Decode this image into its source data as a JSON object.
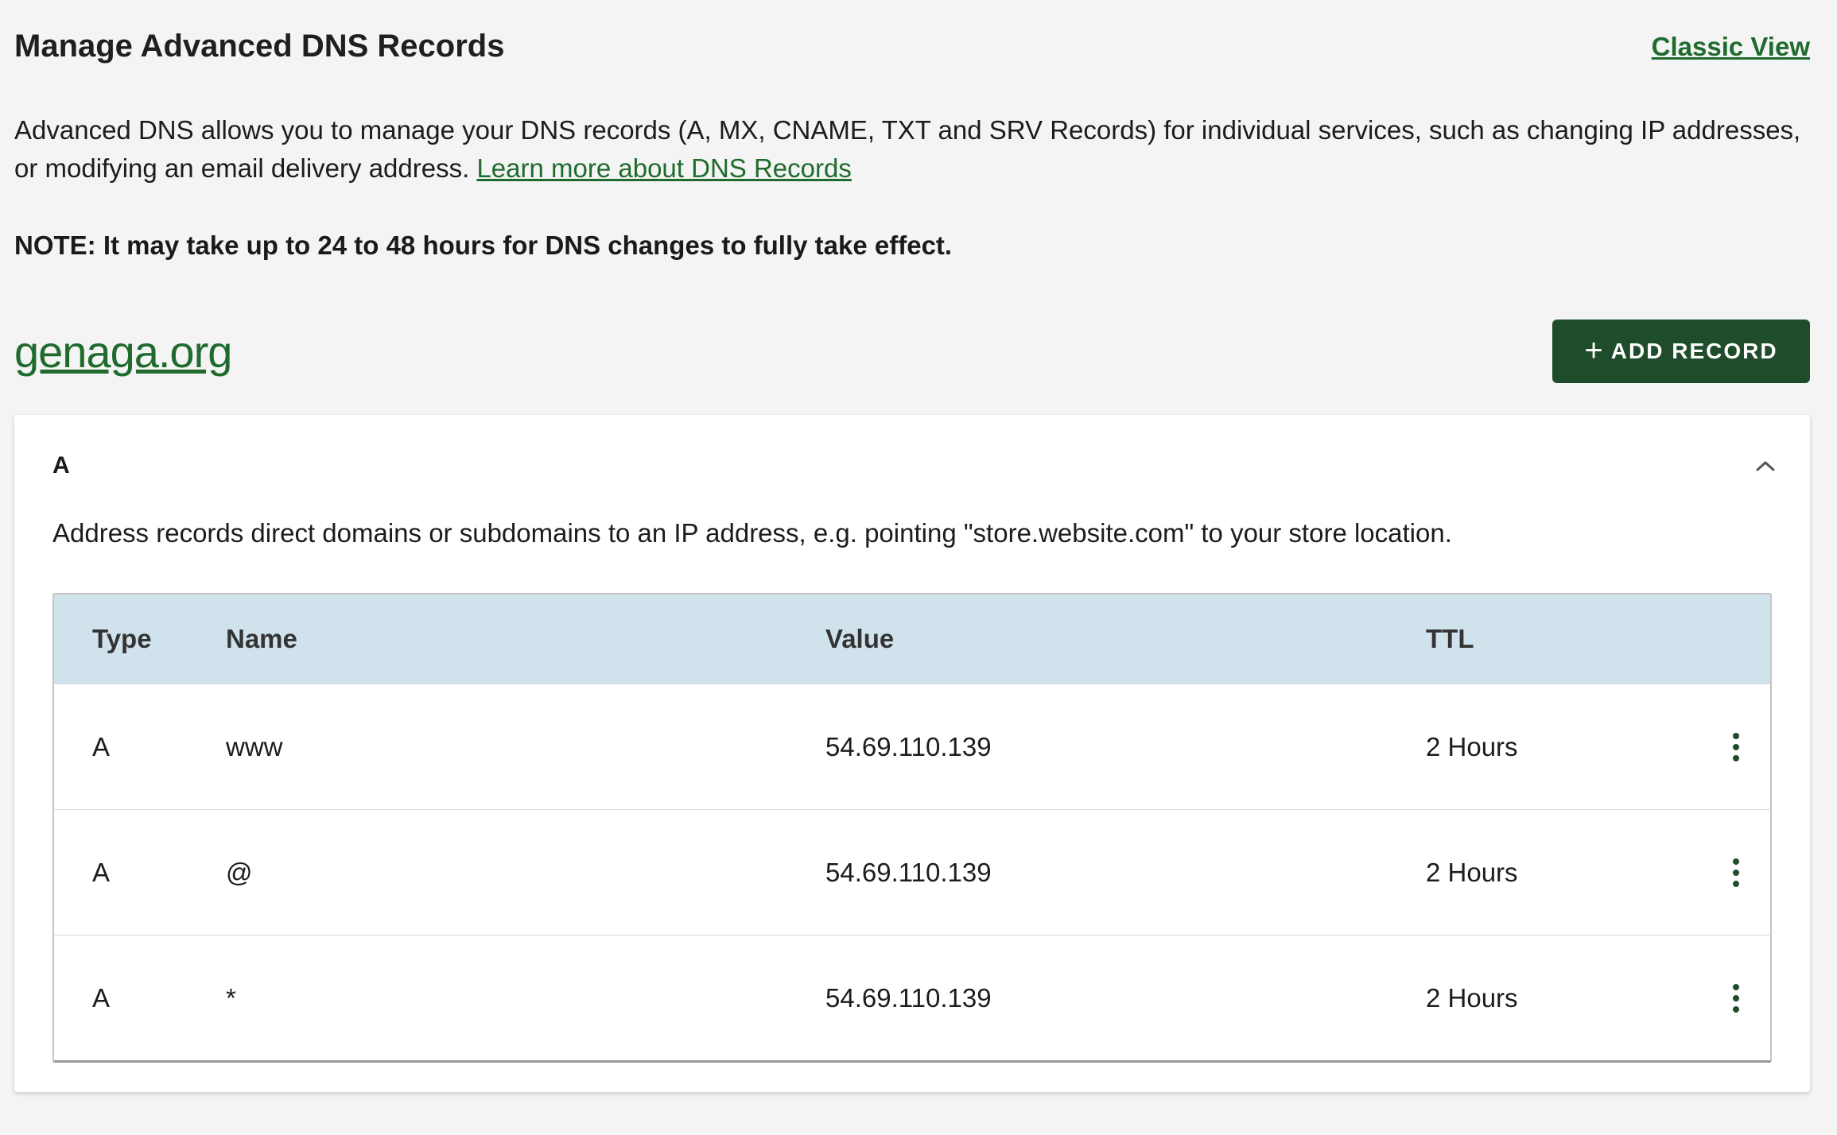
{
  "header": {
    "title": "Manage Advanced DNS Records",
    "classic_view": "Classic View"
  },
  "intro": {
    "text": "Advanced DNS allows you to manage your DNS records (A, MX, CNAME, TXT and SRV Records) for individual services, such as changing IP addresses, or modifying an email delivery address. ",
    "learn_more": "Learn more about DNS Records"
  },
  "note": "NOTE: It may take up to 24 to 48 hours for DNS changes to fully take effect.",
  "domain": {
    "name": "genaga.org",
    "add_record_label": "ADD RECORD",
    "add_record_icon": "plus-icon"
  },
  "section": {
    "title": "A",
    "description": "Address records direct domains or subdomains to an IP address, e.g. pointing \"store.website.com\" to your store location.",
    "collapse_icon": "chevron-up-icon"
  },
  "table": {
    "headers": {
      "type": "Type",
      "name": "Name",
      "value": "Value",
      "ttl": "TTL"
    },
    "rows": [
      {
        "type": "A",
        "name": "www",
        "value": "54.69.110.139",
        "ttl": "2 Hours"
      },
      {
        "type": "A",
        "name": "@",
        "value": "54.69.110.139",
        "ttl": "2 Hours"
      },
      {
        "type": "A",
        "name": "*",
        "value": "54.69.110.139",
        "ttl": "2 Hours"
      }
    ],
    "row_menu_icon": "kebab-menu-icon"
  },
  "colors": {
    "accent_green": "#1f6b2d",
    "button_green": "#1f4d2b",
    "table_header_bg": "#d0e2eb",
    "page_bg": "#f4f4f4"
  }
}
